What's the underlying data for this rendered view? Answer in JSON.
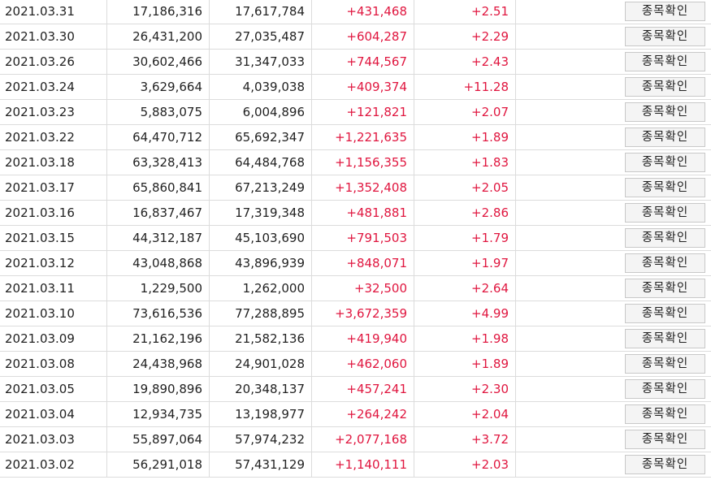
{
  "rows": [
    {
      "date": "2021.03.31",
      "v1": "17,186,316",
      "v2": "17,617,784",
      "change": "+431,468",
      "pct": "+2.51",
      "action": "종목확인"
    },
    {
      "date": "2021.03.30",
      "v1": "26,431,200",
      "v2": "27,035,487",
      "change": "+604,287",
      "pct": "+2.29",
      "action": "종목확인"
    },
    {
      "date": "2021.03.26",
      "v1": "30,602,466",
      "v2": "31,347,033",
      "change": "+744,567",
      "pct": "+2.43",
      "action": "종목확인"
    },
    {
      "date": "2021.03.24",
      "v1": "3,629,664",
      "v2": "4,039,038",
      "change": "+409,374",
      "pct": "+11.28",
      "action": "종목확인"
    },
    {
      "date": "2021.03.23",
      "v1": "5,883,075",
      "v2": "6,004,896",
      "change": "+121,821",
      "pct": "+2.07",
      "action": "종목확인"
    },
    {
      "date": "2021.03.22",
      "v1": "64,470,712",
      "v2": "65,692,347",
      "change": "+1,221,635",
      "pct": "+1.89",
      "action": "종목확인"
    },
    {
      "date": "2021.03.18",
      "v1": "63,328,413",
      "v2": "64,484,768",
      "change": "+1,156,355",
      "pct": "+1.83",
      "action": "종목확인"
    },
    {
      "date": "2021.03.17",
      "v1": "65,860,841",
      "v2": "67,213,249",
      "change": "+1,352,408",
      "pct": "+2.05",
      "action": "종목확인"
    },
    {
      "date": "2021.03.16",
      "v1": "16,837,467",
      "v2": "17,319,348",
      "change": "+481,881",
      "pct": "+2.86",
      "action": "종목확인"
    },
    {
      "date": "2021.03.15",
      "v1": "44,312,187",
      "v2": "45,103,690",
      "change": "+791,503",
      "pct": "+1.79",
      "action": "종목확인"
    },
    {
      "date": "2021.03.12",
      "v1": "43,048,868",
      "v2": "43,896,939",
      "change": "+848,071",
      "pct": "+1.97",
      "action": "종목확인"
    },
    {
      "date": "2021.03.11",
      "v1": "1,229,500",
      "v2": "1,262,000",
      "change": "+32,500",
      "pct": "+2.64",
      "action": "종목확인"
    },
    {
      "date": "2021.03.10",
      "v1": "73,616,536",
      "v2": "77,288,895",
      "change": "+3,672,359",
      "pct": "+4.99",
      "action": "종목확인"
    },
    {
      "date": "2021.03.09",
      "v1": "21,162,196",
      "v2": "21,582,136",
      "change": "+419,940",
      "pct": "+1.98",
      "action": "종목확인"
    },
    {
      "date": "2021.03.08",
      "v1": "24,438,968",
      "v2": "24,901,028",
      "change": "+462,060",
      "pct": "+1.89",
      "action": "종목확인"
    },
    {
      "date": "2021.03.05",
      "v1": "19,890,896",
      "v2": "20,348,137",
      "change": "+457,241",
      "pct": "+2.30",
      "action": "종목확인"
    },
    {
      "date": "2021.03.04",
      "v1": "12,934,735",
      "v2": "13,198,977",
      "change": "+264,242",
      "pct": "+2.04",
      "action": "종목확인"
    },
    {
      "date": "2021.03.03",
      "v1": "55,897,064",
      "v2": "57,974,232",
      "change": "+2,077,168",
      "pct": "+3.72",
      "action": "종목확인"
    },
    {
      "date": "2021.03.02",
      "v1": "56,291,018",
      "v2": "57,431,129",
      "change": "+1,140,111",
      "pct": "+2.03",
      "action": "종목확인"
    }
  ],
  "colors": {
    "positive": "#e0163f",
    "grid_line": "#dcdcdc",
    "button_bg": "#f4f4f4",
    "button_border": "#c8c8c8"
  }
}
